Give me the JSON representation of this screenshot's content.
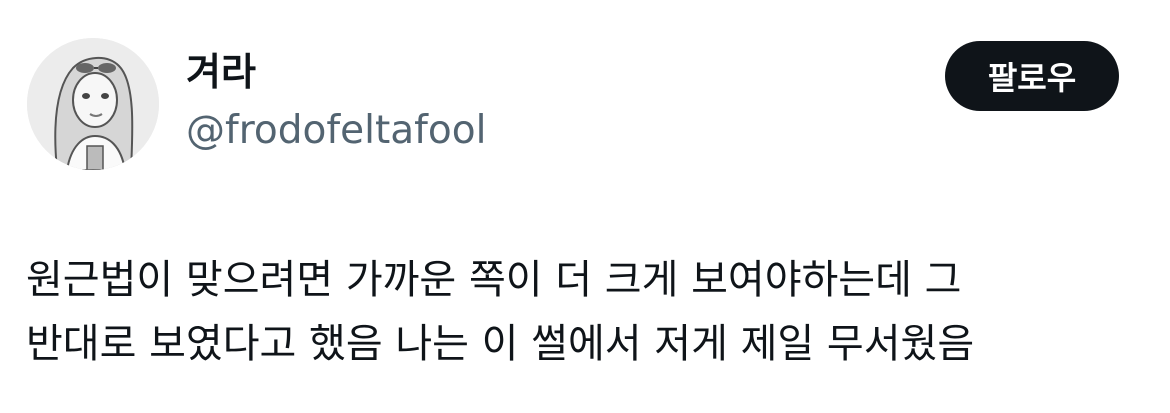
{
  "tweet": {
    "author": {
      "display_name": "겨라",
      "handle": "@frodofeltafool"
    },
    "follow_button_label": "팔로우",
    "text_lines": [
      "원근법이 맞으려면 가까운 쪽이 더 크게 보여야하는데 그",
      "반대로 보였다고 했음 나는 이 썰에서 저게 제일 무서웠음"
    ]
  },
  "colors": {
    "text_primary": "#0f1419",
    "text_secondary": "#536471",
    "follow_button_bg": "#0f1419",
    "follow_button_text": "#ffffff",
    "background": "#ffffff"
  }
}
